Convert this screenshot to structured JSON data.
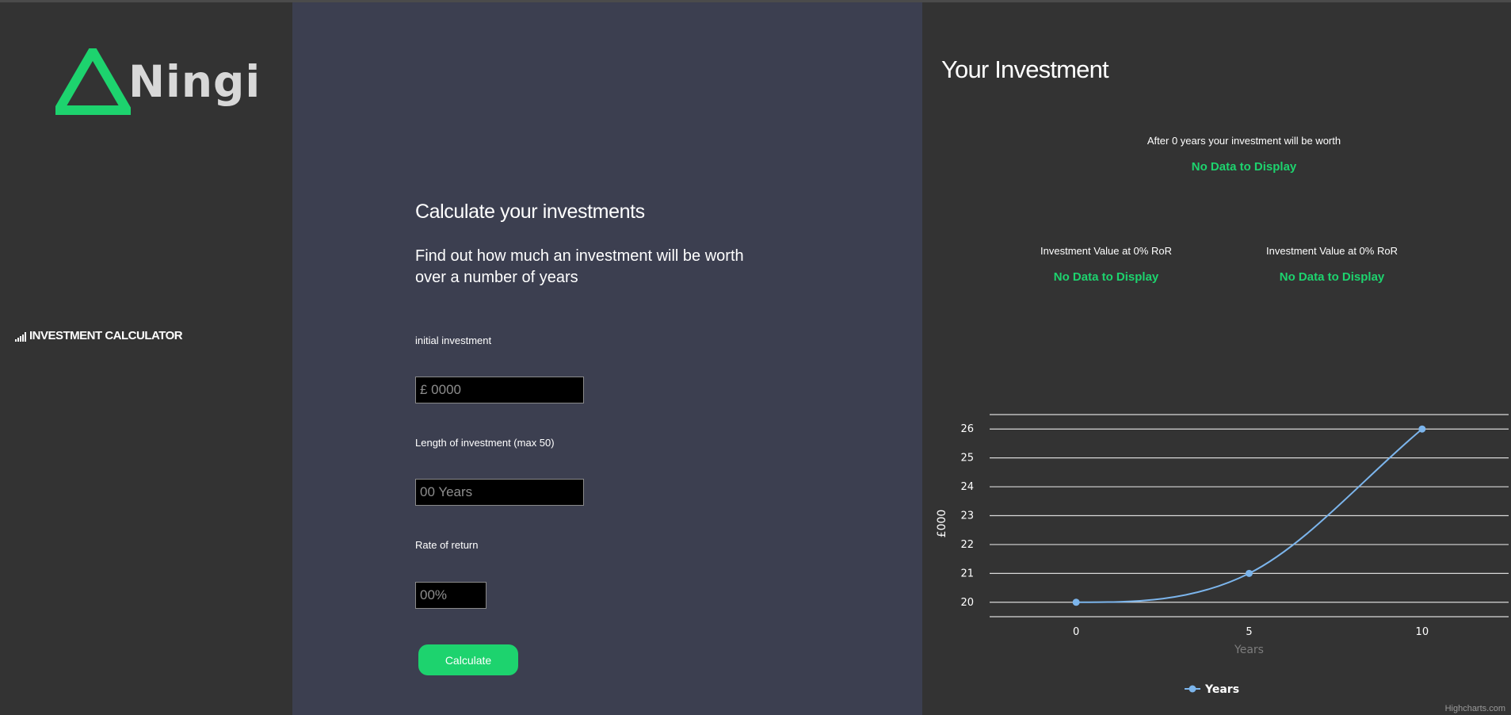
{
  "brand": {
    "name": "Ningi",
    "accent": "#1dd36e"
  },
  "sidebar": {
    "items": [
      {
        "label": "INVESTMENT CALCULATOR",
        "icon": "signal-bars-icon"
      }
    ]
  },
  "calculator": {
    "title": "Calculate your investments",
    "subtitle": "Find out how much an investment will be worth over a number of years",
    "fields": [
      {
        "label": "initial investment",
        "placeholder": "£ 0000"
      },
      {
        "label": "Length of investment (max 50)",
        "placeholder": "00 Years"
      },
      {
        "label": "Rate of return",
        "placeholder": "00%"
      }
    ],
    "button_label": "Calculate"
  },
  "results": {
    "title": "Your Investment",
    "summary_text": "After 0 years your investment will be worth",
    "summary_value": "No Data to Display",
    "columns": [
      {
        "label": "Investment Value at 0% RoR",
        "value": "No Data to Display"
      },
      {
        "label": "Investment Value at 0% RoR",
        "value": "No Data to Display"
      }
    ],
    "credit": "Highcharts.com"
  },
  "chart_data": {
    "type": "line",
    "x": [
      0,
      5,
      10
    ],
    "series": [
      {
        "name": "Years",
        "values": [
          20,
          21,
          26
        ],
        "color": "#7cb5ec"
      }
    ],
    "xlabel": "Years",
    "ylabel": "£000",
    "xticks": [
      "0",
      "5",
      "10"
    ],
    "yticks": [
      "20",
      "21",
      "22",
      "23",
      "24",
      "25",
      "26"
    ],
    "xlim": [
      -2.5,
      12.5
    ],
    "ylim": [
      19.5,
      26.5
    ],
    "grid": true,
    "legend": "bottom"
  }
}
